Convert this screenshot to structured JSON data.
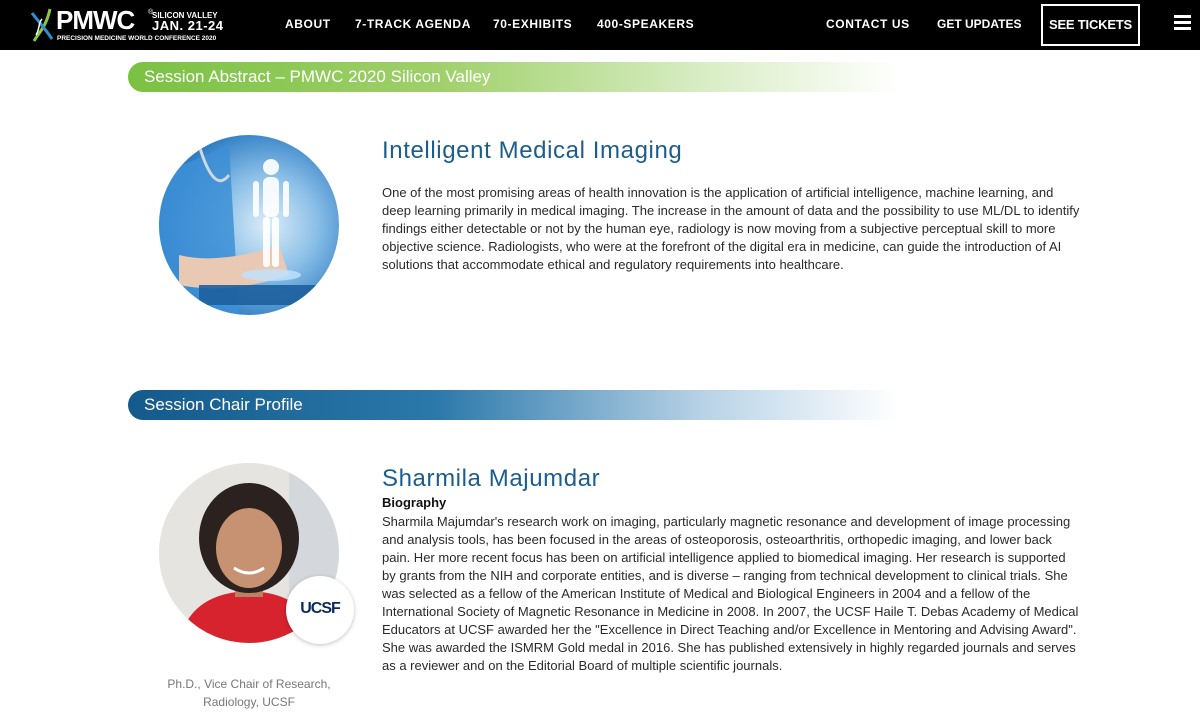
{
  "nav": {
    "logo": {
      "brand": "PMWC",
      "reg": "®",
      "city": "SILICON VALLEY",
      "dates": "JAN. 21-24",
      "subtitle": "PRECISION MEDICINE WORLD CONFERENCE 2020"
    },
    "links": [
      "ABOUT",
      "7-TRACK AGENDA",
      "70-EXHIBITS",
      "400-SPEAKERS"
    ],
    "contact": "CONTACT US",
    "updates": "GET UPDATES",
    "tickets": "SEE TICKETS",
    "menu_icon": "hamburger-icon"
  },
  "abstract": {
    "bar_label": "Session Abstract – PMWC 2020 Silicon Valley",
    "title": "Intelligent Medical Imaging",
    "text": "One of the most promising areas of health innovation is the application of artificial intelligence, machine learning, and deep learning primarily in medical imaging. The increase in the amount of data and the possibility to use ML/DL to identify findings either detectable or not by the human eye, radiology is now moving from a subjective perceptual skill to more objective science. Radiologists, who were at the forefront of the digital era in medicine, can guide the introduction of AI solutions that accommodate ethical and regulatory requirements into healthcare."
  },
  "chair": {
    "bar_label": "Session Chair Profile",
    "name": "Sharmila Majumdar",
    "bio_label": "Biography",
    "bio": "Sharmila Majumdar's research work on imaging, particularly magnetic resonance and development of image processing and analysis tools, has been focused in the areas of osteoporosis, osteoarthritis, orthopedic imaging, and lower back pain. Her more recent focus has been on artificial intelligence applied to biomedical imaging. Her research is supported by grants from the NIH and corporate entities, and is diverse – ranging from technical development to clinical trials. She was selected as a fellow of the American Institute of Medical and Biological Engineers in 2004 and a fellow of the International Society of Magnetic Resonance in Medicine in 2008. In 2007, the UCSF Haile T. Debas Academy of Medical Educators at UCSF awarded her the \"Excellence in Direct Teaching and/or Excellence in Mentoring and Advising Award\". She was awarded the ISMRM Gold medal in 2016. She has published extensively in highly regarded journals and serves as a reviewer and on the Editorial Board of multiple scientific journals.",
    "caption": "Ph.D., Vice Chair of Research, Radiology, UCSF",
    "badge": "UCSF"
  },
  "colors": {
    "nav_bg": "#000000",
    "title_blue": "#1b5e8e",
    "green_bar": "#7ac142",
    "blue_bar": "#145a8c"
  }
}
